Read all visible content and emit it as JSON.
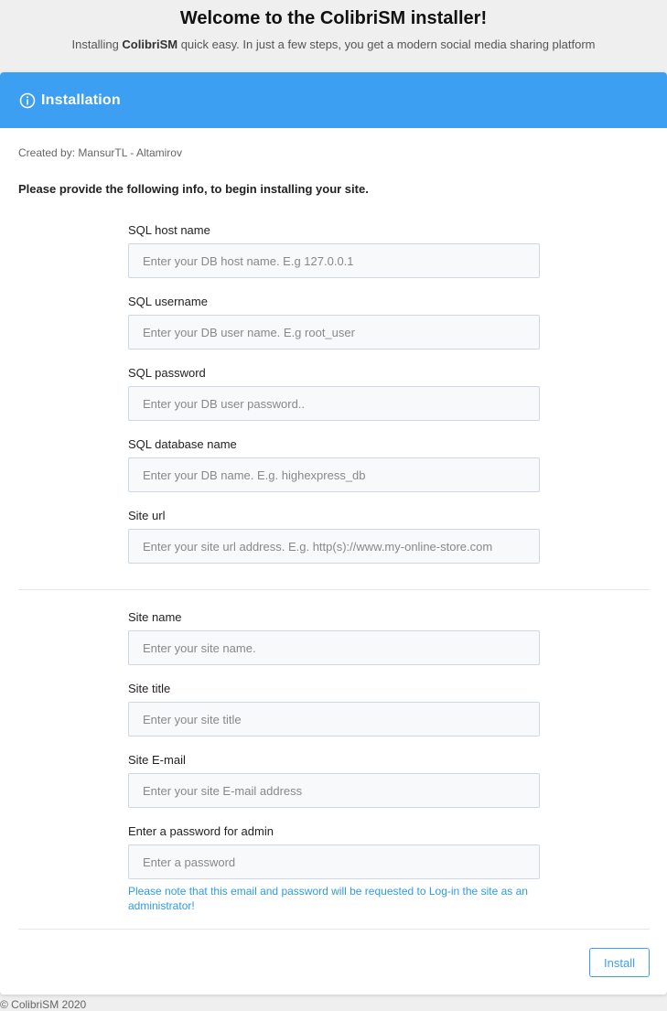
{
  "header": {
    "title": "Welcome to the ColibriSM installer!",
    "subtitle_prefix": "Installing ",
    "subtitle_brand": "ColibriSM",
    "subtitle_suffix": " quick easy. In just a few steps, you get a modern social media sharing platform"
  },
  "card": {
    "icon": "info-circle-icon",
    "title": "Installation",
    "created_by": "Created by: MansurTL - Altamirov",
    "lead": "Please provide the following info, to begin installing your site."
  },
  "fields": [
    {
      "label": "SQL host name",
      "placeholder": "Enter your DB host name. E.g 127.0.0.1",
      "value": ""
    },
    {
      "label": "SQL username",
      "placeholder": "Enter your DB user name. E.g root_user",
      "value": ""
    },
    {
      "label": "SQL password",
      "placeholder": "Enter your DB user password..",
      "value": ""
    },
    {
      "label": "SQL database name",
      "placeholder": "Enter your DB name. E.g. highexpress_db",
      "value": ""
    },
    {
      "label": "Site url",
      "placeholder": "Enter your site url address. E.g. http(s)://www.my-online-store.com",
      "value": ""
    },
    {
      "label": "Site name",
      "placeholder": "Enter your site name.",
      "value": ""
    },
    {
      "label": "Site title",
      "placeholder": "Enter your site title",
      "value": ""
    },
    {
      "label": "Site E-mail",
      "placeholder": "Enter your site E-mail address",
      "value": ""
    },
    {
      "label": "Enter a password for admin",
      "placeholder": "Enter a password",
      "value": ""
    }
  ],
  "note": "Please note that this email and password will be requested to Log-in the site as an administrator!",
  "install_label": "Install",
  "footer": "© ColibriSM 2020",
  "colors": {
    "accent": "#3d9ff2",
    "note": "#2f9be0",
    "input_bg": "#f7f9fb",
    "input_border": "#cfd8e2"
  }
}
